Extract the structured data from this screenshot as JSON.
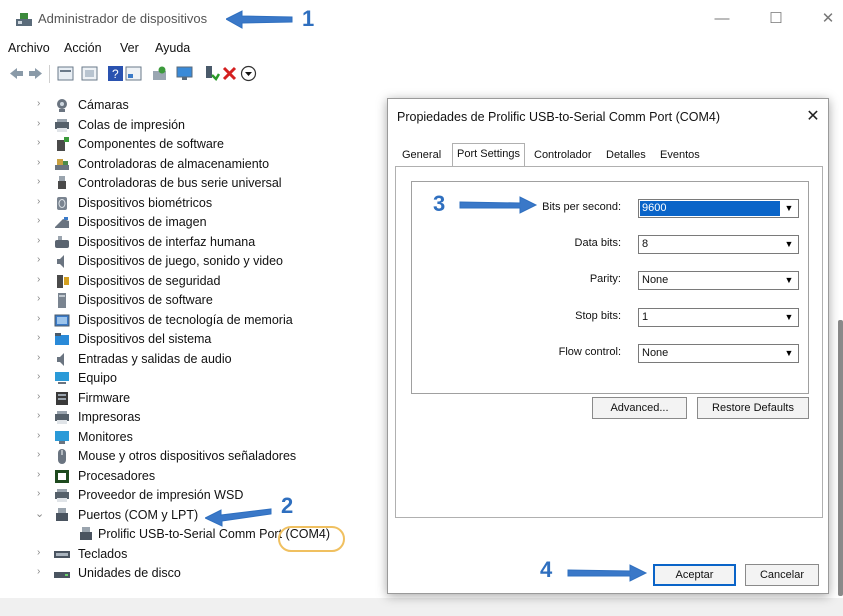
{
  "window": {
    "title": "Administrador de dispositivos",
    "minimize": "—",
    "maximize": "☐",
    "close": "✕"
  },
  "menu": {
    "items": [
      "Archivo",
      "Acción",
      "Ver",
      "Ayuda"
    ]
  },
  "tree": {
    "items": [
      {
        "label": "Cámaras",
        "icon": "camera-icon",
        "expanded": false
      },
      {
        "label": "Colas de impresión",
        "icon": "printer-queue-icon",
        "expanded": false
      },
      {
        "label": "Componentes de software",
        "icon": "software-component-icon",
        "expanded": false
      },
      {
        "label": "Controladoras de almacenamiento",
        "icon": "storage-controller-icon",
        "expanded": false
      },
      {
        "label": "Controladoras de bus serie universal",
        "icon": "usb-icon",
        "expanded": false
      },
      {
        "label": "Dispositivos biométricos",
        "icon": "biometric-icon",
        "expanded": false
      },
      {
        "label": "Dispositivos de imagen",
        "icon": "imaging-device-icon",
        "expanded": false
      },
      {
        "label": "Dispositivos de interfaz humana",
        "icon": "hid-icon",
        "expanded": false
      },
      {
        "label": "Dispositivos de juego, sonido y video",
        "icon": "sound-icon",
        "expanded": false
      },
      {
        "label": "Dispositivos de seguridad",
        "icon": "security-device-icon",
        "expanded": false
      },
      {
        "label": "Dispositivos de software",
        "icon": "software-device-icon",
        "expanded": false
      },
      {
        "label": "Dispositivos de tecnología de memoria",
        "icon": "memory-tech-icon",
        "expanded": false
      },
      {
        "label": "Dispositivos del sistema",
        "icon": "system-device-icon",
        "expanded": false
      },
      {
        "label": "Entradas y salidas de audio",
        "icon": "audio-io-icon",
        "expanded": false
      },
      {
        "label": "Equipo",
        "icon": "computer-icon",
        "expanded": false
      },
      {
        "label": "Firmware",
        "icon": "firmware-icon",
        "expanded": false
      },
      {
        "label": "Impresoras",
        "icon": "printer-icon",
        "expanded": false
      },
      {
        "label": "Monitores",
        "icon": "monitor-icon",
        "expanded": false
      },
      {
        "label": "Mouse y otros dispositivos señaladores",
        "icon": "mouse-icon",
        "expanded": false
      },
      {
        "label": "Procesadores",
        "icon": "processor-icon",
        "expanded": false
      },
      {
        "label": "Proveedor de impresión WSD",
        "icon": "wsd-print-icon",
        "expanded": false
      },
      {
        "label": "Puertos (COM y LPT)",
        "icon": "port-icon",
        "expanded": true
      },
      {
        "label": "Teclados",
        "icon": "keyboard-icon",
        "expanded": false
      },
      {
        "label": "Unidades de disco",
        "icon": "disk-drive-icon",
        "expanded": false
      }
    ],
    "port_child": "Prolific USB-to-Serial Comm Port (COM4)"
  },
  "dialog": {
    "title": "Propiedades de Prolific USB-to-Serial Comm Port (COM4)",
    "close": "✕",
    "tabs": [
      "General",
      "Port Settings",
      "Controlador",
      "Detalles",
      "Eventos"
    ],
    "active_tab": "Port Settings",
    "fields": [
      {
        "label": "Bits per second:",
        "value": "9600"
      },
      {
        "label": "Data bits:",
        "value": "8"
      },
      {
        "label": "Parity:",
        "value": "None"
      },
      {
        "label": "Stop bits:",
        "value": "1"
      },
      {
        "label": "Flow control:",
        "value": "None"
      }
    ],
    "advanced_button": "Advanced...",
    "restore_button": "Restore Defaults",
    "ok_button": "Aceptar",
    "cancel_button": "Cancelar"
  },
  "annotations": [
    "1",
    "2",
    "3",
    "4"
  ],
  "colors": {
    "accent": "#2f6fbf",
    "selection": "#0a64c8",
    "highlight_ring": "#f0c060"
  }
}
